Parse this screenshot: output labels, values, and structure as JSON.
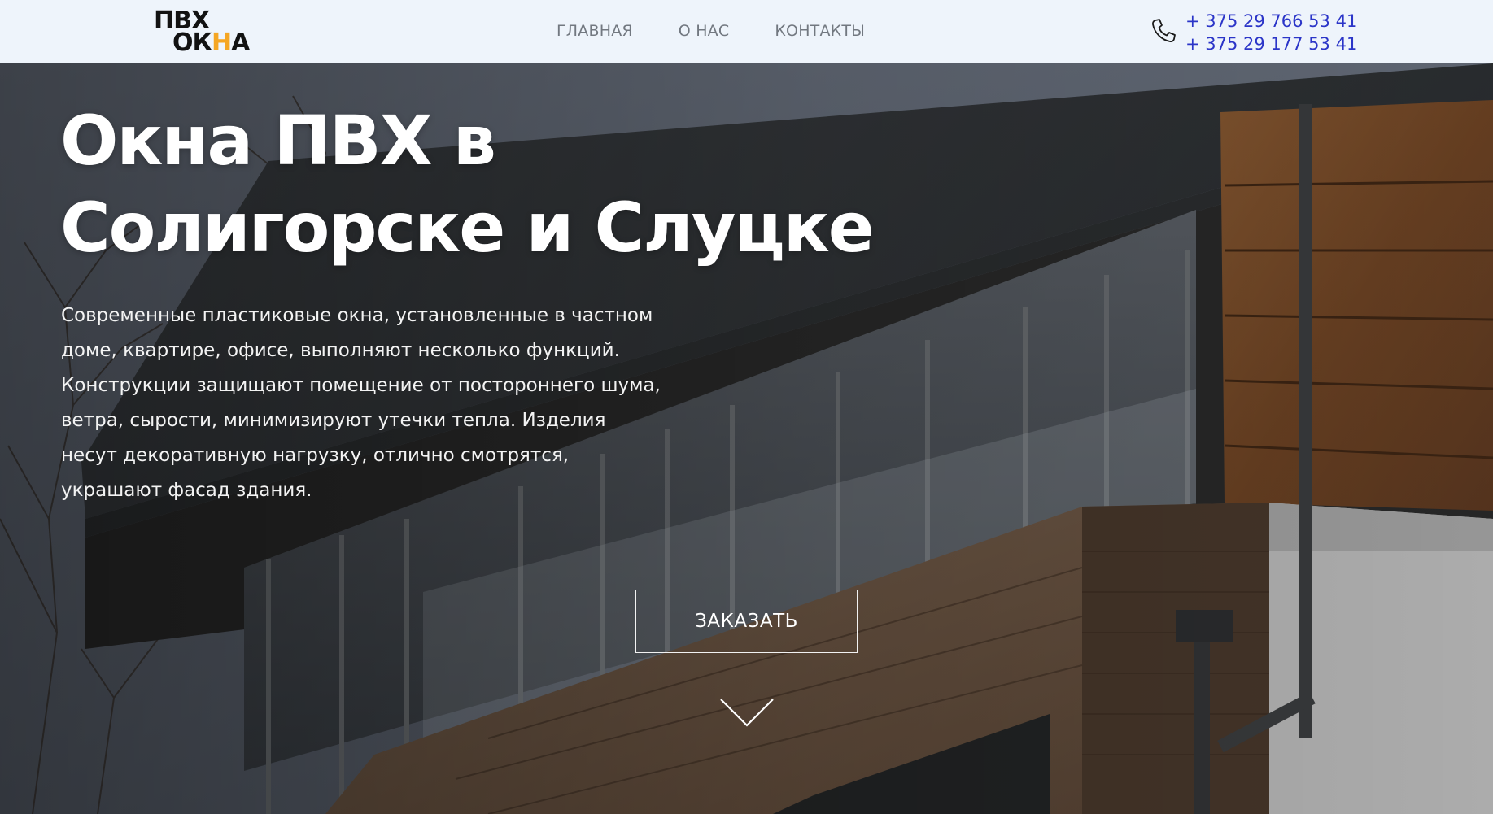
{
  "header": {
    "logo_line1": "ПВХ",
    "logo_line2_a": "ОК",
    "logo_line2_accent": "Н",
    "logo_line2_b": "А",
    "nav": [
      {
        "label": "ГЛАВНАЯ"
      },
      {
        "label": "О НАС"
      },
      {
        "label": "КОНТАКТЫ"
      }
    ],
    "phones": [
      "+ 375 29 766 53 41",
      "+ 375 29 177 53 41"
    ],
    "phone_icon": "phone-icon"
  },
  "hero": {
    "title_line1": "Окна ПВХ в",
    "title_line2": "Солигорске и Слуцке",
    "description": "Современные пластиковые окна, установленные в частном доме, квартире, офисе, выполняют несколько функций. Конструкции защищают помещение от постороннего шума, ветра, сырости, минимизируют утечки тепла. Изделия несут декоративную нагрузку, отлично смотрятся, украшают фасад здания.",
    "order_button": "ЗАКАЗАТЬ",
    "scroll_icon": "chevron-down-icon"
  },
  "colors": {
    "header_bg": "#eef4fb",
    "nav_text": "#727880",
    "phone_text": "#2b35c8",
    "logo_accent": "#f5a623",
    "hero_text": "#ffffff"
  }
}
